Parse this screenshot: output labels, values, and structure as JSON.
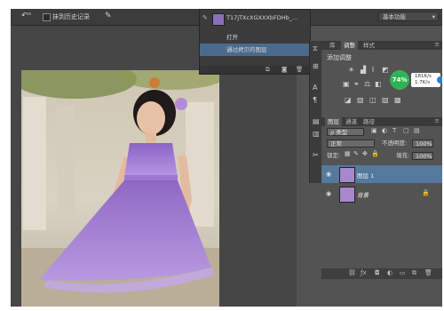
{
  "options_bar": {
    "tool_icon": "history-brush-tool-icon",
    "checkbox_label": "抹到历史记录",
    "workspace_label": "基本功能"
  },
  "history": {
    "items": [
      {
        "label": "T17jTXcXGXXXbFDHb_..."
      },
      {
        "label": "打开"
      },
      {
        "label": "通过拷贝的图层"
      }
    ],
    "selected_index": 2
  },
  "adjustments_panel": {
    "tabs": [
      "库",
      "调整",
      "样式"
    ],
    "active_tab": "调整",
    "title": "添加调整"
  },
  "status_widget": {
    "percent": "74%",
    "upload": "181K/s",
    "download": "1.7K/s"
  },
  "layers_panel": {
    "tabs": [
      "图层",
      "通道",
      "路径"
    ],
    "active_tab": "图层",
    "filter_label": "ρ 类型",
    "blend_mode": "正常",
    "opacity_label": "不透明度:",
    "opacity_value": "100%",
    "lock_label": "锁定:",
    "fill_label": "填充:",
    "fill_value": "100%",
    "layers": [
      {
        "name": "图层 1",
        "selected": true
      },
      {
        "name": "背景",
        "selected": false
      }
    ]
  },
  "colors": {
    "app_bg": "#535353",
    "selection": "#55799c",
    "badge_green": "#2fb455",
    "dress_purple": "#a07ed2"
  }
}
